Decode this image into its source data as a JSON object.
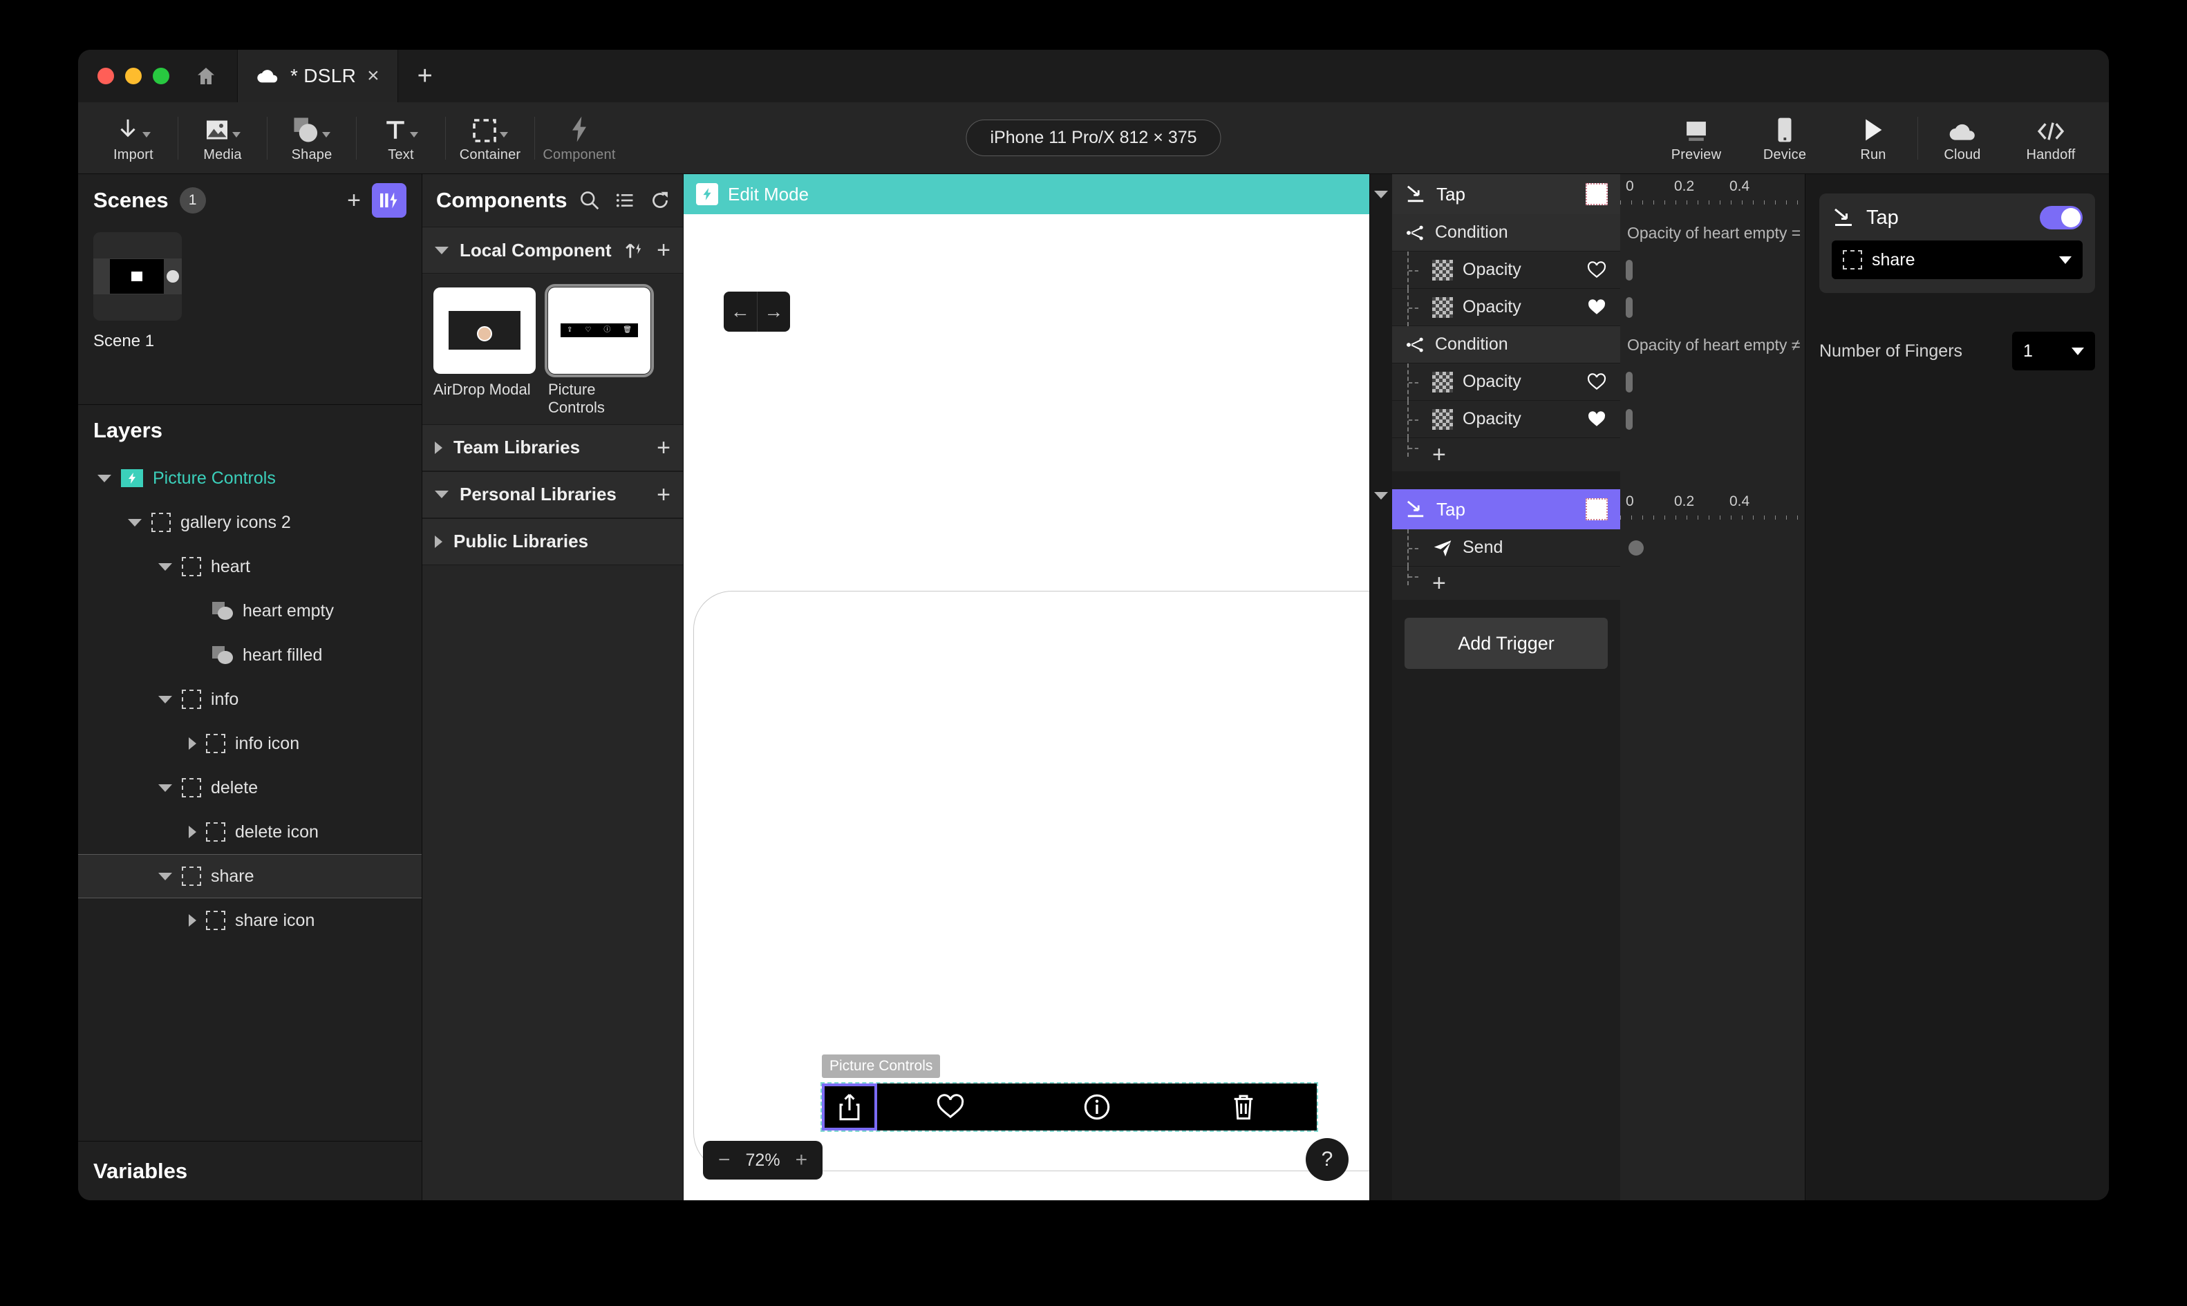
{
  "window": {
    "traffic_lights": [
      "close",
      "minimize",
      "maximize"
    ],
    "home_icon": "home-icon",
    "tab": {
      "cloud_icon": "cloud-icon",
      "title": "* DSLR",
      "close": "×"
    },
    "new_tab": "+"
  },
  "toolbar": {
    "items": [
      {
        "label": "Import",
        "icon": "download-arrow-icon",
        "caret": true,
        "dim": false
      },
      {
        "label": "Media",
        "icon": "image-icon",
        "caret": true,
        "dim": false
      },
      {
        "label": "Shape",
        "icon": "shape-icon",
        "caret": true,
        "dim": false
      },
      {
        "label": "Text",
        "icon": "text-t-icon",
        "caret": true,
        "dim": false
      },
      {
        "label": "Container",
        "icon": "container-dashed-icon",
        "caret": true,
        "dim": false
      },
      {
        "label": "Component",
        "icon": "lightning-icon",
        "caret": false,
        "dim": true
      }
    ],
    "device_pill": "iPhone 11 Pro/X  812 × 375",
    "right_items": [
      {
        "label": "Preview",
        "icon": "preview-screen-icon"
      },
      {
        "label": "Device",
        "icon": "device-phone-icon"
      },
      {
        "label": "Run",
        "icon": "play-triangle-icon"
      },
      {
        "label": "Cloud",
        "icon": "cloud-icon"
      },
      {
        "label": "Handoff",
        "icon": "code-brackets-icon"
      }
    ]
  },
  "scenes": {
    "title": "Scenes",
    "count": "1",
    "add_label": "+",
    "flash_icon": "flash-panel-icon",
    "items": [
      {
        "label": "Scene 1"
      }
    ]
  },
  "layers": {
    "title": "Layers",
    "rows": [
      {
        "name": "Picture Controls",
        "indent": 0,
        "expander": "down",
        "icon": "flash-component-icon",
        "accent": true,
        "selected": false
      },
      {
        "name": "gallery icons 2",
        "indent": 1,
        "expander": "down",
        "icon": "container-dashed-icon",
        "accent": false,
        "selected": false
      },
      {
        "name": "heart",
        "indent": 2,
        "expander": "down",
        "icon": "container-dashed-icon",
        "accent": false,
        "selected": false
      },
      {
        "name": "heart empty",
        "indent": 3,
        "expander": "none",
        "icon": "shape-icon",
        "accent": false,
        "selected": false
      },
      {
        "name": "heart filled",
        "indent": 3,
        "expander": "none",
        "icon": "shape-icon",
        "accent": false,
        "selected": false
      },
      {
        "name": "info",
        "indent": 2,
        "expander": "down",
        "icon": "container-dashed-icon",
        "accent": false,
        "selected": false
      },
      {
        "name": "info icon",
        "indent": 3,
        "expander": "right",
        "icon": "container-dashed-icon",
        "accent": false,
        "selected": false
      },
      {
        "name": "delete",
        "indent": 2,
        "expander": "down",
        "icon": "container-dashed-icon",
        "accent": false,
        "selected": false
      },
      {
        "name": "delete icon",
        "indent": 3,
        "expander": "right",
        "icon": "container-dashed-icon",
        "accent": false,
        "selected": false
      },
      {
        "name": "share",
        "indent": 2,
        "expander": "down",
        "icon": "container-dashed-icon",
        "accent": false,
        "selected": true
      },
      {
        "name": "share icon",
        "indent": 3,
        "expander": "right",
        "icon": "container-dashed-icon",
        "accent": false,
        "selected": false
      }
    ]
  },
  "variables": {
    "title": "Variables"
  },
  "components": {
    "title": "Components",
    "header_icons": [
      "search-icon",
      "list-icon",
      "refresh-icon"
    ],
    "sections": [
      {
        "title": "Local Component",
        "expanded": true,
        "actions": [
          "upload-flash-icon",
          "plus-icon"
        ]
      },
      {
        "title": "Team Libraries",
        "expanded": false,
        "actions": [
          "plus-icon"
        ]
      },
      {
        "title": "Personal Libraries",
        "expanded": true,
        "actions": [
          "plus-icon"
        ]
      },
      {
        "title": "Public Libraries",
        "expanded": false,
        "actions": []
      }
    ],
    "local_items": [
      {
        "name": "AirDrop Modal",
        "selected": false,
        "thumb": "airdrop-modal-thumb"
      },
      {
        "name": "Picture Controls",
        "selected": true,
        "thumb": "picture-controls-thumb"
      }
    ]
  },
  "canvas": {
    "edit_mode_label": "Edit Mode",
    "edit_mode_icon": "flash-icon",
    "nav_back": "←",
    "nav_forward": "→",
    "selection_tag": "Picture Controls",
    "picture_controls_icons": [
      "share-icon",
      "heart-icon",
      "info-icon",
      "trash-icon"
    ],
    "selected_control": "share-icon",
    "zoom": {
      "minus": "−",
      "value": "72%",
      "plus": "+"
    },
    "help": "?"
  },
  "triggers": {
    "add_trigger_label": "Add Trigger",
    "groups": [
      {
        "title": "Tap",
        "icon": "tap-icon",
        "active": false,
        "ruler": [
          "0",
          "0.2",
          "0.4"
        ],
        "rows": [
          {
            "type": "condition",
            "label": "Condition",
            "icon": "condition-icon",
            "timeline_text": "Opacity of heart empty ="
          },
          {
            "type": "action",
            "label": "Opacity",
            "icon": "checker-icon",
            "right_icon": "heart-outline-icon",
            "timeline_keyframe": "bar"
          },
          {
            "type": "action",
            "label": "Opacity",
            "icon": "checker-icon",
            "right_icon": "heart-filled-icon",
            "timeline_keyframe": "bar"
          },
          {
            "type": "condition",
            "label": "Condition",
            "icon": "condition-icon",
            "timeline_text": "Opacity of heart empty ≠"
          },
          {
            "type": "action",
            "label": "Opacity",
            "icon": "checker-icon",
            "right_icon": "heart-outline-icon",
            "timeline_keyframe": "bar"
          },
          {
            "type": "action",
            "label": "Opacity",
            "icon": "checker-icon",
            "right_icon": "heart-filled-icon",
            "timeline_keyframe": "bar"
          },
          {
            "type": "add",
            "label": "+"
          }
        ]
      },
      {
        "title": "Tap",
        "icon": "tap-icon",
        "active": true,
        "ruler": [
          "0",
          "0.2",
          "0.4"
        ],
        "rows": [
          {
            "type": "action",
            "label": "Send",
            "icon": "send-icon",
            "timeline_keyframe": "dot"
          },
          {
            "type": "add",
            "label": "+"
          }
        ]
      }
    ]
  },
  "inspector": {
    "title": "Tap",
    "icon": "tap-icon",
    "enabled": true,
    "target": {
      "label": "share",
      "icon": "container-dashed-icon"
    },
    "fingers_label": "Number of Fingers",
    "fingers_value": "1"
  }
}
